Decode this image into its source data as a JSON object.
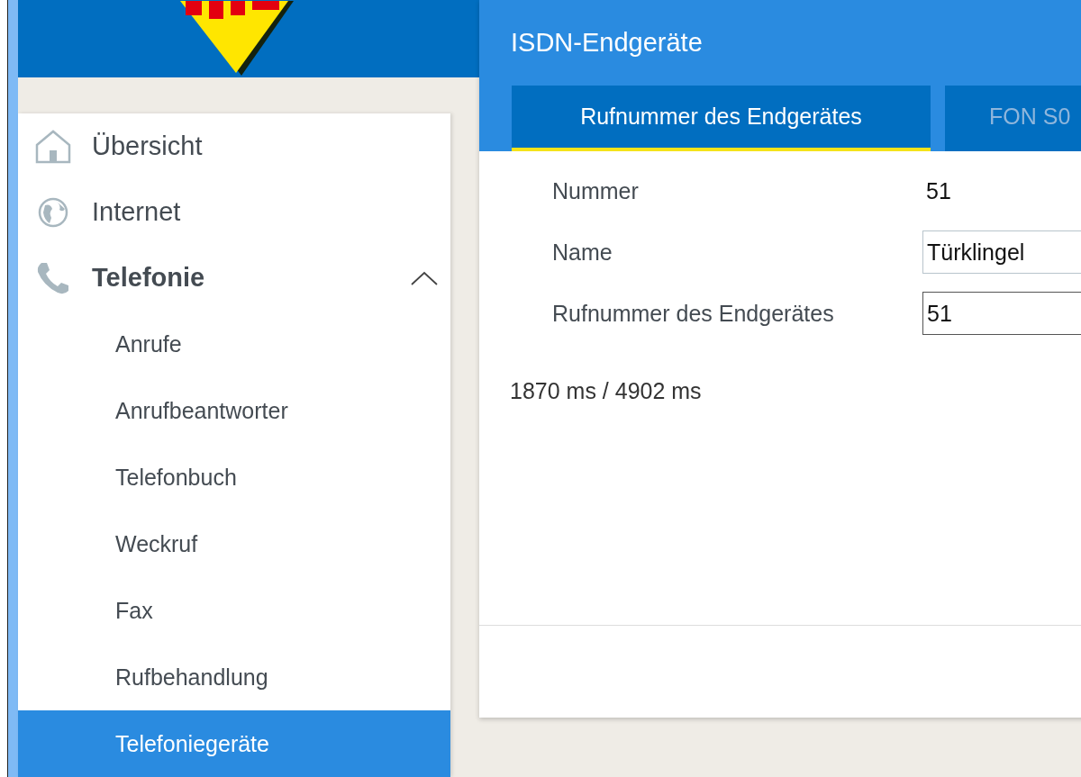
{
  "sidebar": {
    "items": [
      {
        "label": "Übersicht",
        "kind": "home",
        "expanded": false
      },
      {
        "label": "Internet",
        "kind": "globe",
        "expanded": false
      },
      {
        "label": "Telefonie",
        "kind": "phone",
        "expanded": true,
        "children": [
          {
            "label": "Anrufe",
            "selected": false
          },
          {
            "label": "Anrufbeantworter",
            "selected": false
          },
          {
            "label": "Telefonbuch",
            "selected": false
          },
          {
            "label": "Weckruf",
            "selected": false
          },
          {
            "label": "Fax",
            "selected": false
          },
          {
            "label": "Rufbehandlung",
            "selected": false
          },
          {
            "label": "Telefoniegeräte",
            "selected": true
          }
        ]
      }
    ]
  },
  "panel": {
    "title": "ISDN-Endgeräte",
    "tabs": [
      {
        "label": "Rufnummer des Endgerätes",
        "selected": true
      },
      {
        "label": "FON S0",
        "selected": false
      }
    ],
    "fields": [
      {
        "label": "Nummer",
        "kind": "text",
        "value": "51"
      },
      {
        "label": "Name",
        "kind": "input",
        "value": "Türklingel"
      },
      {
        "label": "Rufnummer des Endgerätes",
        "kind": "input",
        "value": "51"
      }
    ],
    "timing": "1870 ms / 4902 ms"
  }
}
